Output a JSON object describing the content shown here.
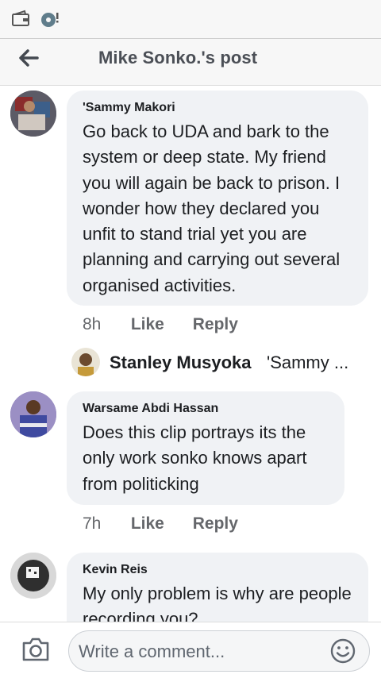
{
  "header": {
    "title": "Mike Sonko.'s post"
  },
  "comments": [
    {
      "author": "'Sammy Makori",
      "text": "Go back to UDA and bark to the system or deep state. My friend you will again be back to prison. I wonder how they declared you unfit to stand trial yet you are planning and carrying out several organised activities.",
      "time": "8h",
      "like": "Like",
      "reply": "Reply"
    },
    {
      "author": "Warsame Abdi Hassan",
      "text": "Does this clip portrays its the only work sonko knows apart from politicking",
      "time": "7h",
      "like": "Like",
      "reply": "Reply"
    },
    {
      "author": "Kevin Reis",
      "text": "My only problem is why are people recording you?"
    }
  ],
  "reply_preview": {
    "name": "Stanley Musyoka",
    "text": "'Sammy ..."
  },
  "composer": {
    "placeholder": "Write a comment..."
  },
  "icons": {
    "status": [
      "wallet-icon",
      "music-disc-icon"
    ],
    "back": "back-arrow-icon",
    "camera": "camera-icon",
    "emoji": "smiley-icon"
  }
}
